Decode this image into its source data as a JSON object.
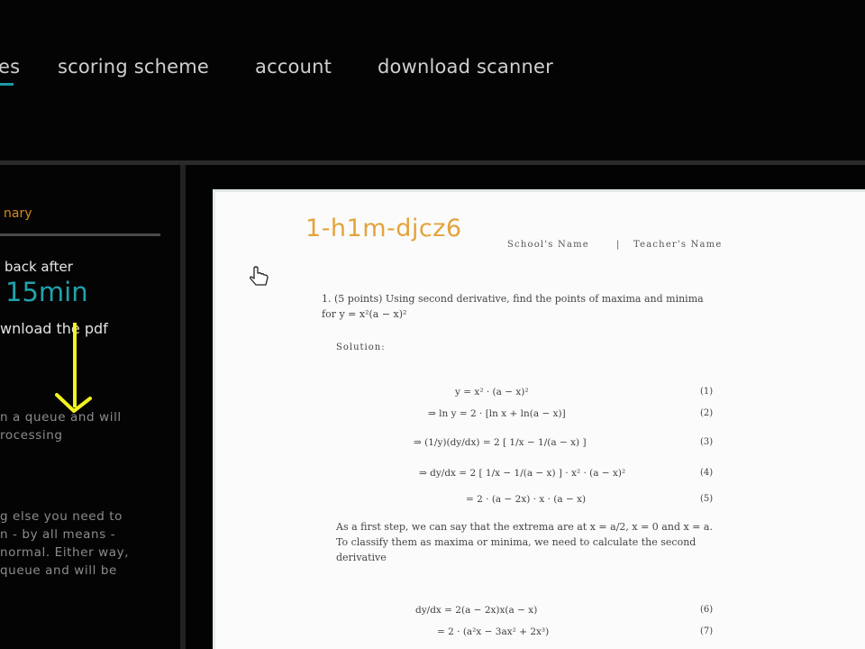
{
  "nav": {
    "items": [
      "es",
      "scoring scheme",
      "account",
      "download scanner"
    ]
  },
  "sidebar": {
    "summary_title": "nary",
    "back_after_label": "back after",
    "wait_time": "15min",
    "download_pdf_label": "wnload the pdf",
    "queue_info": [
      "n a queue and will",
      "rocessing"
    ],
    "more_info": [
      "g else you need to",
      "n - by all means -",
      "normal. Either way,",
      "queue and will be"
    ]
  },
  "document": {
    "code": "1-h1m-djcz6",
    "school_name": "School's Name",
    "separator": "|",
    "teacher_name": "Teacher's Name",
    "question": "1. (5 points) Using second derivative, find the points of maxima and minima for y = x²(a − x)²",
    "solution_label": "Solution:",
    "equations": [
      {
        "expr": "y = x² · (a − x)²",
        "num": "(1)"
      },
      {
        "expr": "⇒ ln y = 2 · [ln x + ln(a − x)]",
        "num": "(2)"
      },
      {
        "expr": "⇒ (1/y)(dy/dx) = 2 [ 1/x − 1/(a − x) ]",
        "num": "(3)"
      },
      {
        "expr": "⇒ dy/dx = 2 [ 1/x − 1/(a − x) ] · x² · (a − x)²",
        "num": "(4)"
      },
      {
        "expr": "= 2 · (a − 2x) · x · (a − x)",
        "num": "(5)"
      }
    ],
    "paragraph": "As a first step, we can say that the extrema are at x = a/2, x = 0 and x = a. To classify them as maxima or minima, we need to calculate the second derivative",
    "equations2": [
      {
        "expr": "dy/dx = 2(a − 2x)x(a − x)",
        "num": "(6)"
      },
      {
        "expr": "= 2 · (a²x − 3ax² + 2x³)",
        "num": "(7)"
      }
    ]
  },
  "colors": {
    "accent_teal": "#1fa3ad",
    "accent_orange": "#e4a33b",
    "arrow_yellow": "#f2f21e"
  }
}
